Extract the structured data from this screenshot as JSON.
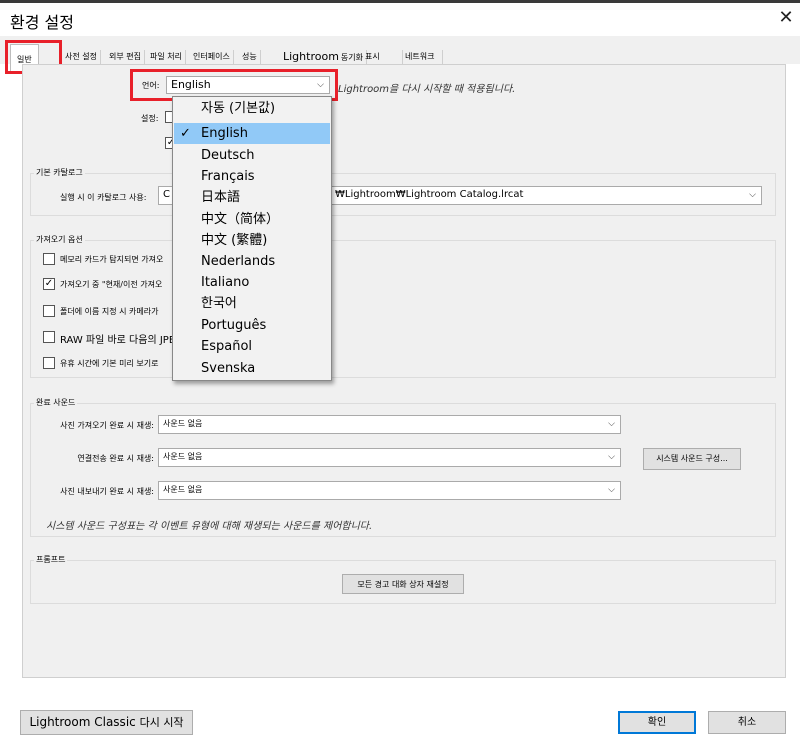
{
  "window": {
    "title": "환경 설정",
    "close_glyph": "✕"
  },
  "tabs": [
    {
      "label": "일반",
      "active": true
    },
    {
      "label": "사전 설정"
    },
    {
      "label": "외부 편집"
    },
    {
      "label": "파일 처리"
    },
    {
      "label": "인터페이스"
    },
    {
      "label": "성능"
    },
    {
      "label": "Lightroom",
      "label_suffix": "동기화"
    },
    {
      "label": "표시"
    },
    {
      "label": "네트워크"
    }
  ],
  "general": {
    "language_label": "언어:",
    "language_value": "English",
    "language_hint": "Lightroom을 다시 시작할 때 적용됩니다.",
    "settings_label": "설정:"
  },
  "language_options": [
    {
      "label": "자동 (기본값)"
    },
    {
      "label": "English",
      "selected": true
    },
    {
      "label": "Deutsch"
    },
    {
      "label": "Français"
    },
    {
      "label": "日本語"
    },
    {
      "label": "中文（简体）"
    },
    {
      "label": "中文 (繁體)"
    },
    {
      "label": "Nederlands"
    },
    {
      "label": "Italiano"
    },
    {
      "label": "한국어"
    },
    {
      "label": "Português"
    },
    {
      "label": "Español"
    },
    {
      "label": "Svenska"
    }
  ],
  "catalog": {
    "group_label": "기본 카탈로그",
    "startup_label": "실행 시 이 카탈로그 사용:",
    "value_prefix": "C",
    "value_suffix": "₩Lightroom₩Lightroom Catalog.lrcat"
  },
  "import": {
    "group_label": "가져오기 옵션",
    "options": [
      {
        "label": "메모리 카드가 탐지되면 가져오",
        "checked": false
      },
      {
        "label": "가져오기 중 \"현재/이전 가져오",
        "checked": true
      },
      {
        "label": "폴더에 이름 지정 시 카메라가",
        "checked": false
      },
      {
        "label": "RAW 파일 바로 다음의 JPE",
        "checked": false
      },
      {
        "label": "유휴 시간에 기본 미리 보기로",
        "checked": false
      }
    ]
  },
  "sound": {
    "group_label": "완료 사운드",
    "rows": [
      {
        "label": "사진 가져오기 완료 시 재생:",
        "value": "사운드 없음"
      },
      {
        "label": "연결전송 완료 시 재생:",
        "value": "사운드 없음"
      },
      {
        "label": "사진 내보내기 완료 시 재생:",
        "value": "사운드 없음"
      }
    ],
    "system_sounds_button": "시스템 사운드 구성...",
    "note": "시스템 사운드 구성표는 각 이벤트 유형에 대해 재생되는 사운드를 제어합니다."
  },
  "prompts": {
    "group_label": "프롬프트",
    "reset_button": "모든 경고 대화 상자 재설정"
  },
  "footer": {
    "restart_button_bold": "Lightroom Classic",
    "restart_button_rest": "다시 시작",
    "ok_button": "확인",
    "cancel_button": "취소"
  },
  "colors": {
    "highlight_red": "#e8202a",
    "selected_option": "#91c9f7",
    "primary_border": "#0078d7"
  }
}
